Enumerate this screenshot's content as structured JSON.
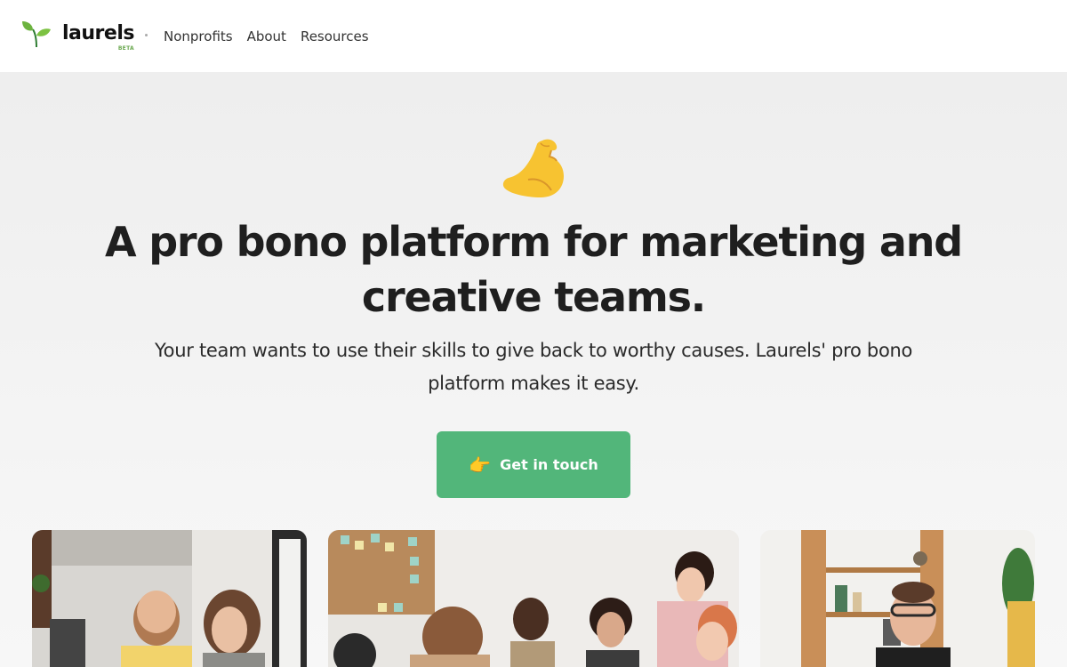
{
  "brand": {
    "name": "laurels",
    "badge": "BETA",
    "logo_icon": "sprout-icon",
    "accent": "#6aa84f"
  },
  "nav": {
    "items": [
      {
        "label": "Nonprofits"
      },
      {
        "label": "About"
      },
      {
        "label": "Resources"
      }
    ]
  },
  "hero": {
    "emoji_icon": "flexed-biceps-icon",
    "title": "A pro bono platform for marketing and creative teams.",
    "subtitle": "Your team wants to use their skills to give back to worthy causes. Laurels' pro bono platform makes it easy.",
    "cta": {
      "label": "Get in touch",
      "icon": "pointing-right-hand-icon",
      "color": "#52b67a"
    }
  },
  "photos": [
    {
      "name": "team-photo-office"
    },
    {
      "name": "team-photo-meeting"
    },
    {
      "name": "team-photo-portrait"
    }
  ]
}
